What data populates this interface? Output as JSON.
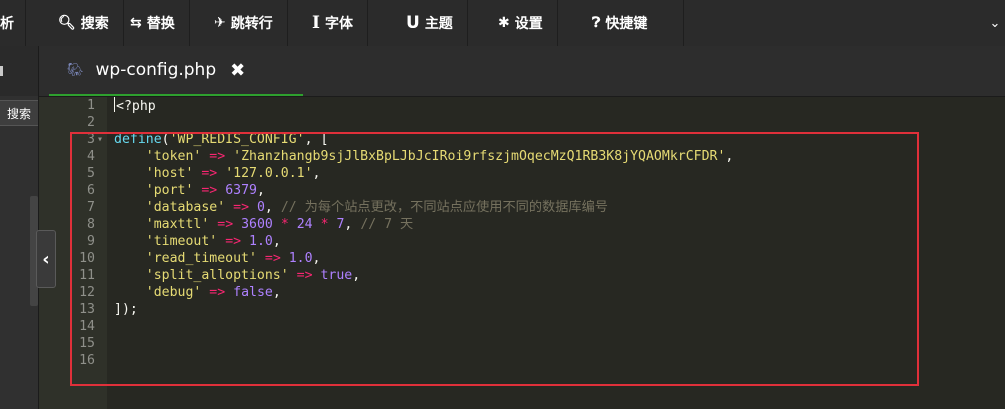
{
  "toolbar": {
    "cut_label": "析",
    "items": [
      {
        "icon": "search-icon",
        "glyph": "🔍︎",
        "label": "搜索"
      },
      {
        "icon": "replace-icon",
        "glyph": "⇆",
        "label": "替换"
      },
      {
        "icon": "pin-icon",
        "glyph": "✈︎",
        "label": "跳转行"
      },
      {
        "icon": "font-icon",
        "glyph": "I",
        "label": "字体"
      },
      {
        "icon": "theme-icon",
        "glyph": "U",
        "label": "主题"
      },
      {
        "icon": "gear-icon",
        "glyph": "✱",
        "label": "设置"
      },
      {
        "icon": "question-icon",
        "glyph": "❓︎",
        "label": "快捷键"
      }
    ],
    "overflow_glyph": "⌄"
  },
  "sidebar": {
    "search_label": "搜索",
    "collapse_glyph": "‹"
  },
  "tab": {
    "filename": "wp-config.php",
    "file_icon": "elephant-php-icon",
    "file_glyph": "🐘︎",
    "close_glyph": "✖"
  },
  "colors": {
    "highlight_box": "#e0303a",
    "active_tab_underline": "#2ea02e"
  },
  "code": [
    {
      "n": "1",
      "fold": "",
      "tokens": [
        {
          "c": "",
          "t": "<?php",
          "cursor": true
        }
      ]
    },
    {
      "n": "2",
      "fold": "",
      "tokens": []
    },
    {
      "n": "3",
      "fold": "▾",
      "tokens": [
        {
          "c": "fn",
          "t": "define"
        },
        {
          "c": "",
          "t": "("
        },
        {
          "c": "str",
          "t": "'WP_REDIS_CONFIG'"
        },
        {
          "c": "",
          "t": ", ["
        }
      ]
    },
    {
      "n": "4",
      "fold": "",
      "tokens": [
        {
          "c": "",
          "t": "    "
        },
        {
          "c": "str",
          "t": "'token'"
        },
        {
          "c": "",
          "t": " "
        },
        {
          "c": "op",
          "t": "=>"
        },
        {
          "c": "",
          "t": " "
        },
        {
          "c": "str",
          "t": "'Zhanzhangb9sjJlBxBpLJbJcIRoi9rfszjmOqecMzQ1RB3K8jYQAOMkrCFDR'"
        },
        {
          "c": "",
          "t": ","
        }
      ]
    },
    {
      "n": "5",
      "fold": "",
      "tokens": [
        {
          "c": "",
          "t": "    "
        },
        {
          "c": "str",
          "t": "'host'"
        },
        {
          "c": "",
          "t": " "
        },
        {
          "c": "op",
          "t": "=>"
        },
        {
          "c": "",
          "t": " "
        },
        {
          "c": "str",
          "t": "'127.0.0.1'"
        },
        {
          "c": "",
          "t": ","
        }
      ]
    },
    {
      "n": "6",
      "fold": "",
      "tokens": [
        {
          "c": "",
          "t": "    "
        },
        {
          "c": "str",
          "t": "'port'"
        },
        {
          "c": "",
          "t": " "
        },
        {
          "c": "op",
          "t": "=>"
        },
        {
          "c": "",
          "t": " "
        },
        {
          "c": "num",
          "t": "6379"
        },
        {
          "c": "",
          "t": ","
        }
      ]
    },
    {
      "n": "7",
      "fold": "",
      "tokens": [
        {
          "c": "",
          "t": "    "
        },
        {
          "c": "str",
          "t": "'database'"
        },
        {
          "c": "",
          "t": " "
        },
        {
          "c": "op",
          "t": "=>"
        },
        {
          "c": "",
          "t": " "
        },
        {
          "c": "num",
          "t": "0"
        },
        {
          "c": "",
          "t": ", "
        },
        {
          "c": "cm",
          "t": "// 为每个站点更改，不同站点应使用不同的数据库编号"
        }
      ]
    },
    {
      "n": "8",
      "fold": "",
      "tokens": [
        {
          "c": "",
          "t": "    "
        },
        {
          "c": "str",
          "t": "'maxttl'"
        },
        {
          "c": "",
          "t": " "
        },
        {
          "c": "op",
          "t": "=>"
        },
        {
          "c": "",
          "t": " "
        },
        {
          "c": "num",
          "t": "3600"
        },
        {
          "c": "",
          "t": " "
        },
        {
          "c": "op",
          "t": "*"
        },
        {
          "c": "",
          "t": " "
        },
        {
          "c": "num",
          "t": "24"
        },
        {
          "c": "",
          "t": " "
        },
        {
          "c": "op",
          "t": "*"
        },
        {
          "c": "",
          "t": " "
        },
        {
          "c": "num",
          "t": "7"
        },
        {
          "c": "",
          "t": ", "
        },
        {
          "c": "cm",
          "t": "// 7 天"
        }
      ]
    },
    {
      "n": "9",
      "fold": "",
      "tokens": [
        {
          "c": "",
          "t": "    "
        },
        {
          "c": "str",
          "t": "'timeout'"
        },
        {
          "c": "",
          "t": " "
        },
        {
          "c": "op",
          "t": "=>"
        },
        {
          "c": "",
          "t": " "
        },
        {
          "c": "num",
          "t": "1.0"
        },
        {
          "c": "",
          "t": ","
        }
      ]
    },
    {
      "n": "10",
      "fold": "",
      "tokens": [
        {
          "c": "",
          "t": "    "
        },
        {
          "c": "str",
          "t": "'read_timeout'"
        },
        {
          "c": "",
          "t": " "
        },
        {
          "c": "op",
          "t": "=>"
        },
        {
          "c": "",
          "t": " "
        },
        {
          "c": "num",
          "t": "1.0"
        },
        {
          "c": "",
          "t": ","
        }
      ]
    },
    {
      "n": "11",
      "fold": "",
      "tokens": [
        {
          "c": "",
          "t": "    "
        },
        {
          "c": "str",
          "t": "'split_alloptions'"
        },
        {
          "c": "",
          "t": " "
        },
        {
          "c": "op",
          "t": "=>"
        },
        {
          "c": "",
          "t": " "
        },
        {
          "c": "kw",
          "t": "true"
        },
        {
          "c": "",
          "t": ","
        }
      ]
    },
    {
      "n": "12",
      "fold": "",
      "tokens": [
        {
          "c": "",
          "t": "    "
        },
        {
          "c": "str",
          "t": "'debug'"
        },
        {
          "c": "",
          "t": " "
        },
        {
          "c": "op",
          "t": "=>"
        },
        {
          "c": "",
          "t": " "
        },
        {
          "c": "kw",
          "t": "false"
        },
        {
          "c": "",
          "t": ","
        }
      ]
    },
    {
      "n": "13",
      "fold": "",
      "tokens": [
        {
          "c": "",
          "t": "]);"
        }
      ]
    },
    {
      "n": "14",
      "fold": "",
      "tokens": []
    },
    {
      "n": "15",
      "fold": "",
      "tokens": []
    },
    {
      "n": "16",
      "fold": "",
      "tokens": []
    }
  ]
}
